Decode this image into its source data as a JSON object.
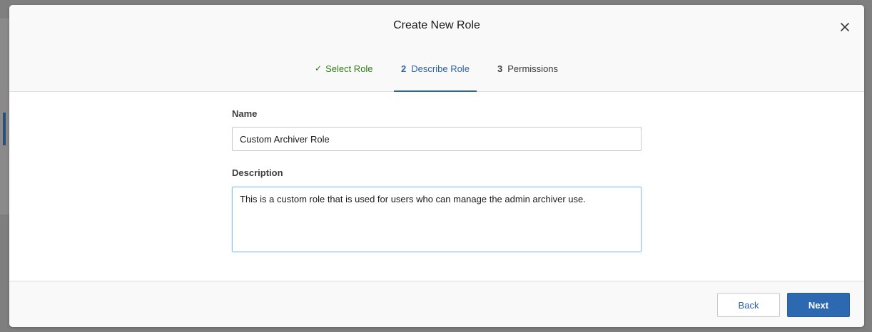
{
  "modal": {
    "title": "Create New Role",
    "close_icon": "close-icon"
  },
  "steps": [
    {
      "label": "Select Role",
      "status": "complete",
      "icon": "check-icon",
      "glyph": "✓"
    },
    {
      "number": "2",
      "label": "Describe Role",
      "status": "active"
    },
    {
      "number": "3",
      "label": "Permissions",
      "status": "pending"
    }
  ],
  "form": {
    "name": {
      "label": "Name",
      "value": "Custom Archiver Role"
    },
    "description": {
      "label": "Description",
      "value": "This is a custom role that is used for users who can manage the admin archiver use."
    }
  },
  "footer": {
    "back_label": "Back",
    "next_label": "Next"
  },
  "colors": {
    "accent": "#2c62a6",
    "primary_button": "#2c69b0",
    "complete": "#2e7d16",
    "focus_border": "#8cc3ec"
  }
}
